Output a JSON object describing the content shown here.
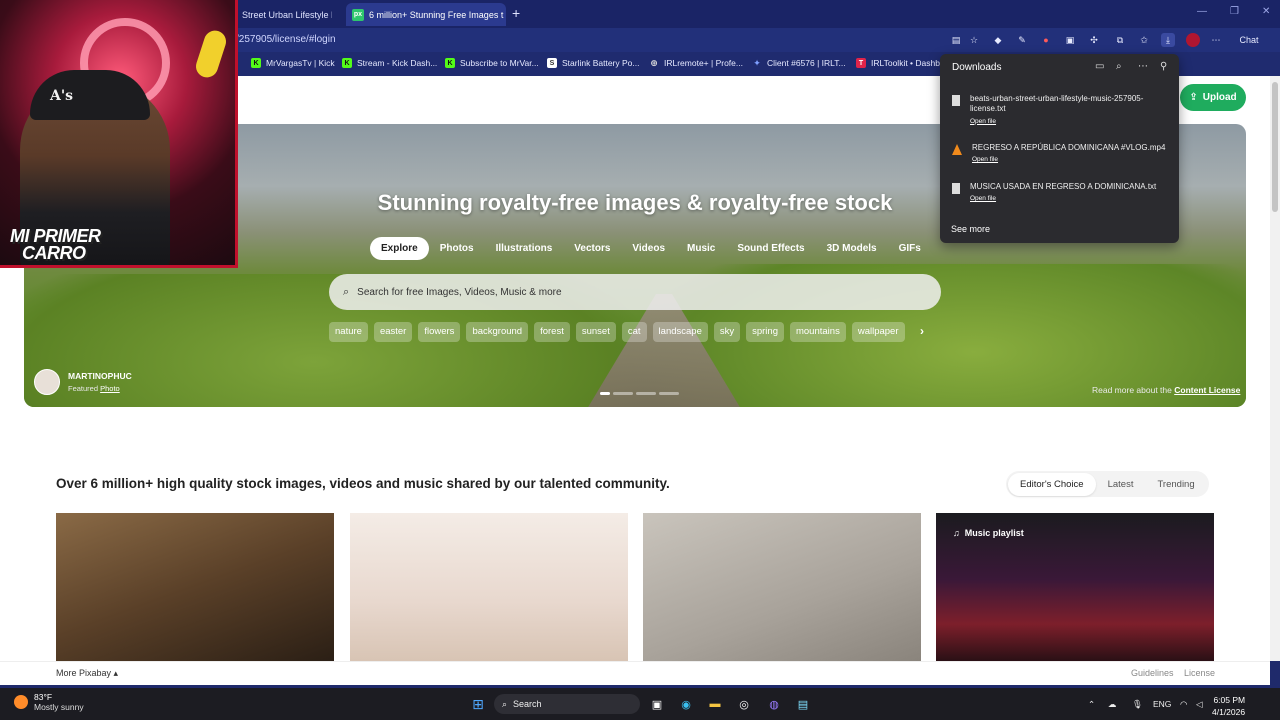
{
  "browser": {
    "tabs": [
      {
        "title": "Street Urban Lifestyle Mu",
        "active": false
      },
      {
        "title": "6 million+ Stunning Free Images t",
        "active": true
      }
    ],
    "new_tab": "+",
    "url": "/257905/license/#login",
    "chat_label": "Chat"
  },
  "bookmarks": [
    {
      "label": "MrVargasTv | Kick",
      "color": "#53fc18",
      "icon": "K"
    },
    {
      "label": "Stream - Kick Dash...",
      "color": "#53fc18",
      "icon": "K"
    },
    {
      "label": "Subscribe to MrVar...",
      "color": "#53fc18",
      "icon": "K"
    },
    {
      "label": "Starlink Battery Po...",
      "color": "#ffffff",
      "icon": "S"
    },
    {
      "label": "IRLremote+ | Profe...",
      "color": "#bbbbbb",
      "icon": "globe"
    },
    {
      "label": "Client #6576 | IRLT...",
      "color": "#7fa0ff",
      "icon": "star"
    },
    {
      "label": "IRLToolkit • Dashb...",
      "color": "#e0244a",
      "icon": "T"
    }
  ],
  "downloads": {
    "title": "Downloads",
    "items": [
      {
        "name": "beats-urban-street-urban-lifestyle-music-257905-license.txt",
        "action": "Open file",
        "type": "file-icon"
      },
      {
        "name": "REGRESO A REPÚBLICA DOMINICANA #VLOG.mp4",
        "action": "Open file",
        "type": "vlc-icon"
      },
      {
        "name": "MUSICA USADA EN REGRESO A DOMINICANA.txt",
        "action": "Open file",
        "type": "file-icon"
      }
    ],
    "see_more": "See more"
  },
  "header": {
    "upload_label": "Upload"
  },
  "hero": {
    "title": "Stunning royalty-free images & royalty-free stock",
    "tabs": [
      "Explore",
      "Photos",
      "Illustrations",
      "Vectors",
      "Videos",
      "Music",
      "Sound Effects",
      "3D Models",
      "GIFs"
    ],
    "active_tab": "Explore",
    "search_placeholder": "Search for free Images, Videos, Music & more",
    "chips": [
      "nature",
      "easter",
      "flowers",
      "background",
      "forest",
      "sunset",
      "cat",
      "landscape",
      "sky",
      "spring",
      "mountains",
      "wallpaper"
    ],
    "photographer": "MARTINOPHUC",
    "featured_label": "Featured",
    "featured_link": "Photo",
    "license_prefix": "Read more about the",
    "license_link": "Content License"
  },
  "main": {
    "section_title": "Over 6 million+ high quality stock images, videos and music shared by our talented community.",
    "sort_options": [
      "Editor's Choice",
      "Latest",
      "Trending"
    ],
    "active_sort": "Editor's Choice",
    "playlist_tag": "Music playlist"
  },
  "footer": {
    "more_label": "More Pixabay ▴",
    "guidelines": "Guidelines",
    "license": "License"
  },
  "webcam": {
    "cap_text": "A's",
    "overlay_line1": "MI PRIMER",
    "overlay_line2": "CARRO"
  },
  "taskbar": {
    "temperature": "83°F",
    "weather": "Mostly sunny",
    "search_label": "Search",
    "lang": "ENG",
    "time": "6:05 PM",
    "date": "4/1/2026"
  }
}
